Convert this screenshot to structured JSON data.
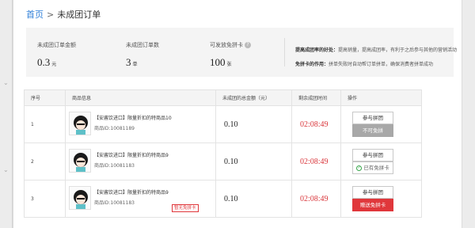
{
  "breadcrumb": {
    "home": "首页",
    "separator": ">",
    "current": "未成团订单"
  },
  "stats": {
    "amount": {
      "label": "未成团订单金额",
      "value": "0.3",
      "unit": "元"
    },
    "count": {
      "label": "未成团订单数",
      "value": "3",
      "unit": "单"
    },
    "cards": {
      "label": "可发放免拼卡",
      "value": "100",
      "unit": "张"
    }
  },
  "tips": {
    "row1_title": "提高成团率的好处：",
    "row1_text": "提高销量，提高成团率，有利于之后参与其他的营销活动",
    "row2_title": "免拼卡的作用：",
    "row2_text": "拼单失败时自动帮订单拼单，确保消费者拼单成功"
  },
  "table": {
    "headers": [
      "序号",
      "商品信息",
      "未成团的总金额（元）",
      "剩余成团时间",
      "操作"
    ],
    "rows": [
      {
        "index": "1",
        "name": "【安酱饮进口】限量折扣的特商品10",
        "pid": "商品ID:10081189",
        "amount": "0.10",
        "time": "02:08:49",
        "join": "参与拼团",
        "action": "不可免拼",
        "action_type": "disabled",
        "tag": ""
      },
      {
        "index": "2",
        "name": "【安酱饮进口】限量折扣的特商品9",
        "pid": "商品ID:10081183",
        "amount": "0.10",
        "time": "02:08:49",
        "join": "参与拼团",
        "action": "已有免拼卡",
        "action_type": "owned",
        "tag": ""
      },
      {
        "index": "3",
        "name": "【安酱饮进口】限量折扣的特商品9",
        "pid": "商品ID:10081183",
        "amount": "0.10",
        "time": "02:08:49",
        "join": "参与拼团",
        "action": "赠送免拼卡",
        "action_type": "gift",
        "tag": "暂无免拼卡"
      }
    ]
  },
  "colors": {
    "accent_red": "#e0373b",
    "link_blue": "#2f7fd8",
    "disabled_gray": "#a8a8a8",
    "success_green": "#37a64a"
  }
}
